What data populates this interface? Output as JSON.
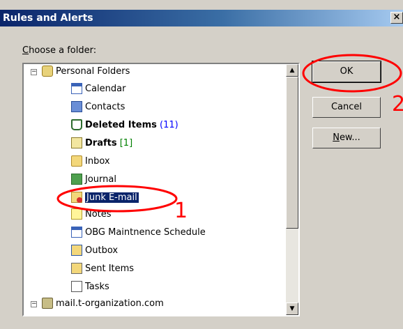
{
  "window": {
    "title": "Rules and Alerts",
    "close_label": "×"
  },
  "chooser": {
    "label_prefix": "C",
    "label_rest": "hoose a folder:"
  },
  "tree": {
    "root": {
      "label": "Personal Folders",
      "expander": "−",
      "icon": "personal-folders-icon"
    },
    "items": [
      {
        "label": "Calendar",
        "icon": "calendar-icon"
      },
      {
        "label": "Contacts",
        "icon": "contacts-icon"
      },
      {
        "label": "Deleted Items",
        "count": "(11)",
        "bold": true,
        "icon": "deleted-items-icon"
      },
      {
        "label": "Drafts",
        "count": "[1]",
        "bold": true,
        "icon": "drafts-icon"
      },
      {
        "label": "Inbox",
        "icon": "inbox-icon"
      },
      {
        "label": "Journal",
        "icon": "journal-icon"
      },
      {
        "label": "Junk E-mail",
        "icon": "junk-email-icon",
        "selected": true
      },
      {
        "label": "Notes",
        "icon": "notes-icon"
      },
      {
        "label": "OBG Maintnence Schedule",
        "icon": "calendar-icon"
      },
      {
        "label": "Outbox",
        "icon": "outbox-icon"
      },
      {
        "label": "Sent Items",
        "icon": "sent-items-icon"
      },
      {
        "label": "Tasks",
        "icon": "tasks-icon"
      }
    ],
    "second_root": {
      "label": "mail.t-organization.com",
      "expander": "−",
      "icon": "mailbox-icon"
    }
  },
  "buttons": {
    "ok": "OK",
    "cancel": "Cancel",
    "new_prefix": "N",
    "new_rest": "ew..."
  },
  "annotations": {
    "marker_1": "1",
    "marker_2": "2",
    "color": "#ff0000"
  },
  "colors": {
    "titlebar_start": "#0a246a",
    "selection": "#0a246a",
    "face": "#d4d0c8"
  }
}
